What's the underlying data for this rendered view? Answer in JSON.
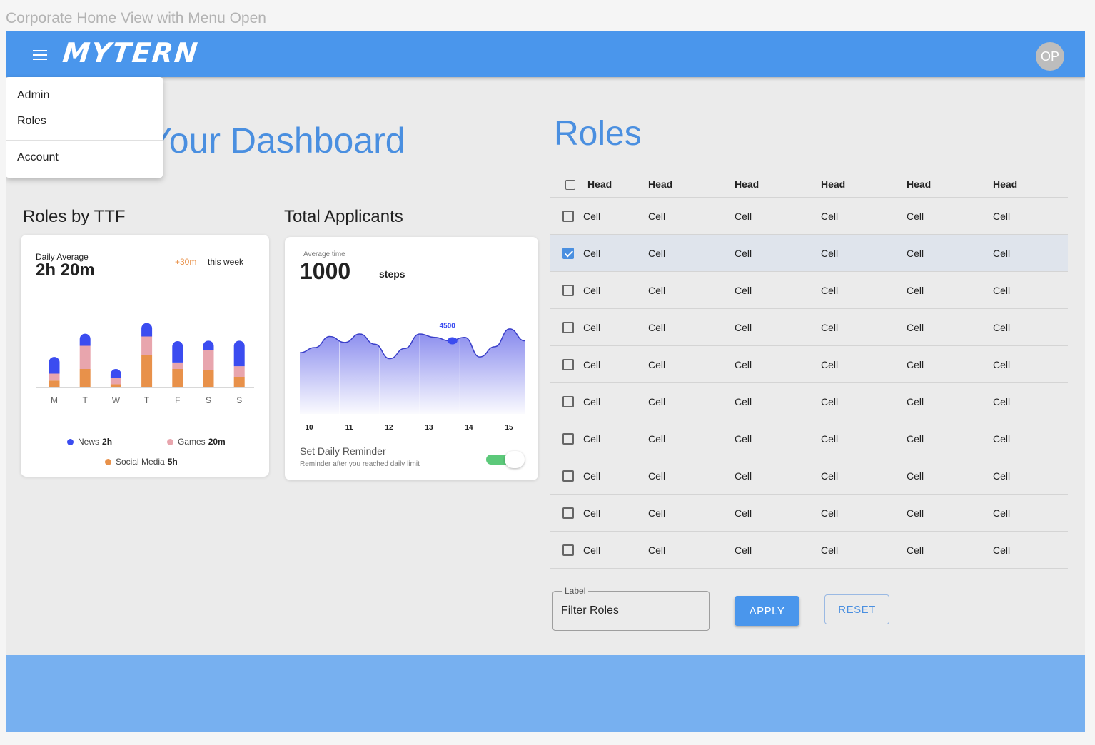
{
  "frame_title": "Corporate Home View with Menu Open",
  "header": {
    "logo": "MYTERN",
    "avatar_initials": "OP"
  },
  "menu": {
    "items": [
      "Admin",
      "Roles"
    ],
    "account": "Account"
  },
  "dashboard": {
    "heading": "Your Dashboard"
  },
  "roles_by_ttf": {
    "title": "Roles by TTF",
    "daily_average_label": "Daily Average",
    "daily_average_value": "2h 20m",
    "delta": "+30m",
    "delta_period": "this week",
    "legend": [
      {
        "name": "News",
        "value": "2h",
        "color": "#3b4cf0"
      },
      {
        "name": "Games",
        "value": "20m",
        "color": "#e8a5ad"
      },
      {
        "name": "Social Media",
        "value": "5h",
        "color": "#e8914a"
      }
    ]
  },
  "total_applicants": {
    "title": "Total Applicants",
    "average_label": "Average time",
    "value": "1000",
    "unit": "steps",
    "reminder_title": "Set Daily Reminder",
    "reminder_subtitle": "Reminder after you reached daily limit",
    "reminder_enabled": true
  },
  "roles_table": {
    "title": "Roles",
    "headers": [
      "Head",
      "Head",
      "Head",
      "Head",
      "Head",
      "Head"
    ],
    "rows": [
      {
        "checked": false,
        "cells": [
          "Cell",
          "Cell",
          "Cell",
          "Cell",
          "Cell",
          "Cell"
        ]
      },
      {
        "checked": true,
        "cells": [
          "Cell",
          "Cell",
          "Cell",
          "Cell",
          "Cell",
          "Cell"
        ]
      },
      {
        "checked": false,
        "cells": [
          "Cell",
          "Cell",
          "Cell",
          "Cell",
          "Cell",
          "Cell"
        ]
      },
      {
        "checked": false,
        "cells": [
          "Cell",
          "Cell",
          "Cell",
          "Cell",
          "Cell",
          "Cell"
        ]
      },
      {
        "checked": false,
        "cells": [
          "Cell",
          "Cell",
          "Cell",
          "Cell",
          "Cell",
          "Cell"
        ]
      },
      {
        "checked": false,
        "cells": [
          "Cell",
          "Cell",
          "Cell",
          "Cell",
          "Cell",
          "Cell"
        ]
      },
      {
        "checked": false,
        "cells": [
          "Cell",
          "Cell",
          "Cell",
          "Cell",
          "Cell",
          "Cell"
        ]
      },
      {
        "checked": false,
        "cells": [
          "Cell",
          "Cell",
          "Cell",
          "Cell",
          "Cell",
          "Cell"
        ]
      },
      {
        "checked": false,
        "cells": [
          "Cell",
          "Cell",
          "Cell",
          "Cell",
          "Cell",
          "Cell"
        ]
      },
      {
        "checked": false,
        "cells": [
          "Cell",
          "Cell",
          "Cell",
          "Cell",
          "Cell",
          "Cell"
        ]
      }
    ]
  },
  "filter": {
    "label": "Label",
    "value": "Filter Roles",
    "apply": "APPLY",
    "reset": "RESET"
  },
  "chart_data": [
    {
      "type": "bar",
      "stacked": true,
      "categories": [
        "M",
        "T",
        "W",
        "T",
        "F",
        "S",
        "S"
      ],
      "series": [
        {
          "name": "Social Media",
          "color": "#e8914a",
          "values": [
            1.5,
            4.0,
            0.7,
            7.0,
            4.0,
            3.7,
            2.2
          ]
        },
        {
          "name": "Games",
          "color": "#e8a5ad",
          "values": [
            1.5,
            5.0,
            1.3,
            4.0,
            1.4,
            4.4,
            2.4
          ]
        },
        {
          "name": "News",
          "color": "#3b4cf0",
          "values": [
            3.6,
            2.6,
            2.0,
            2.9,
            4.6,
            2.0,
            5.5
          ]
        }
      ]
    },
    {
      "type": "area",
      "x": [
        10,
        11,
        12,
        13,
        14,
        15
      ],
      "x_ticks": [
        "10",
        "11",
        "12",
        "13",
        "14",
        "15"
      ],
      "values": [
        3600,
        3900,
        4550,
        4200,
        4700,
        4100,
        3250,
        3850,
        4700,
        4500,
        4300,
        4500,
        3350,
        3950,
        5000,
        4300
      ],
      "highlight": {
        "x": 13.6,
        "value": 4300,
        "label": "4500"
      },
      "ylim": [
        0,
        6000
      ]
    }
  ]
}
